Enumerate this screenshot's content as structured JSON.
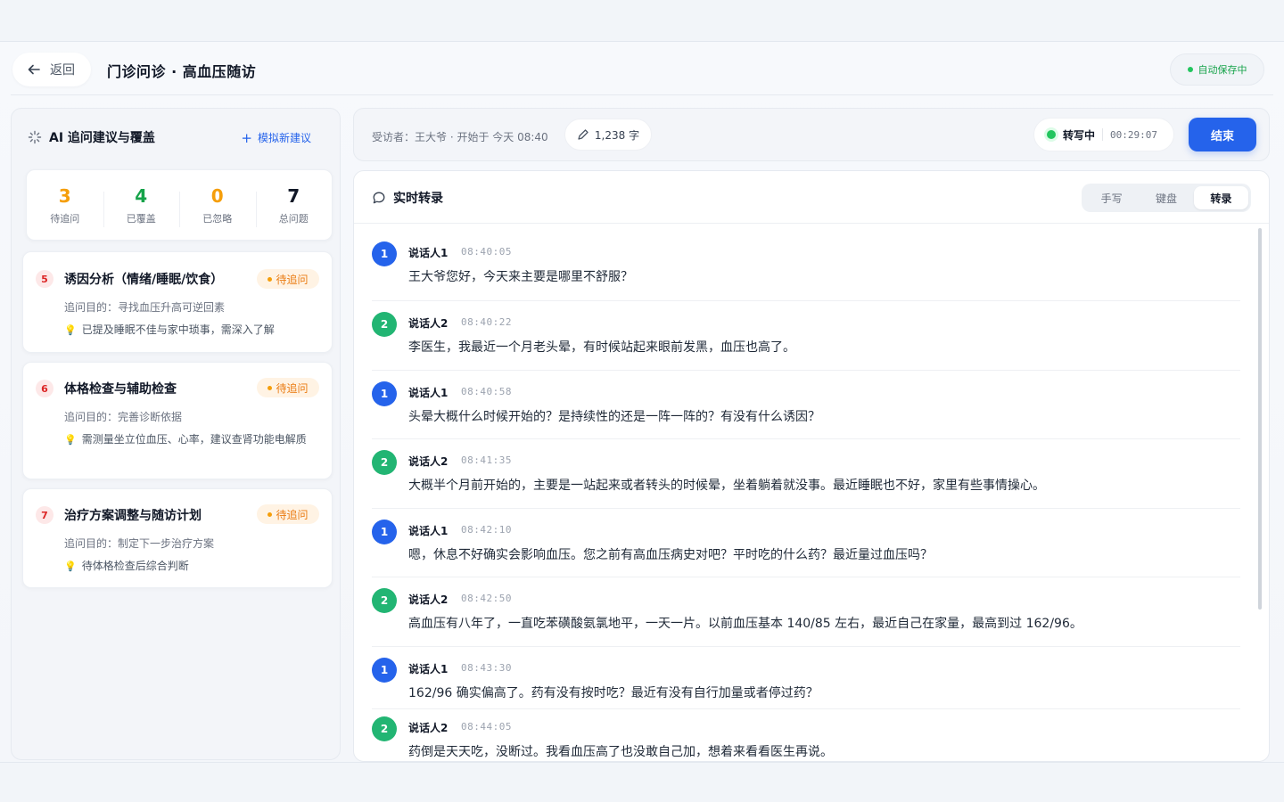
{
  "header": {
    "back_label": "返回",
    "title": "门诊问诊 · 高血压随访",
    "autosave": "自动保存中"
  },
  "left": {
    "title": "AI 追问建议与覆盖",
    "action": "模拟新建议",
    "stats": [
      {
        "value": "3",
        "label": "待追问",
        "color": "#f59e0b"
      },
      {
        "value": "4",
        "label": "已覆盖",
        "color": "#16a34a"
      },
      {
        "value": "0",
        "label": "已忽略",
        "color": "#f59e0b"
      },
      {
        "value": "7",
        "label": "总问题",
        "color": "#111827"
      }
    ],
    "questions": [
      {
        "num": "5",
        "title": "诱因分析（情绪/睡眠/饮食）",
        "badge": "待追问",
        "purpose": "追问目的：寻找血压升高可逆回素",
        "note": "已提及睡眠不佳与家中琐事，需深入了解"
      },
      {
        "num": "6",
        "title": "体格检查与辅助检查",
        "badge": "待追问",
        "purpose": "追问目的：完善诊断依据",
        "note": "需测量坐立位血压、心率，建议查肾功能电解质"
      },
      {
        "num": "7",
        "title": "治疗方案调整与随访计划",
        "badge": "待追问",
        "purpose": "追问目的：制定下一步治疗方案",
        "note": "待体格检查后综合判断"
      }
    ]
  },
  "topbar": {
    "meta": "受访者：王大爷 · 开始于 今天 08:40",
    "word_count": "1,238 字",
    "rec_label": "转写中",
    "rec_time": "00:29:07",
    "end_label": "结束"
  },
  "transcript": {
    "title": "实时转录",
    "modes": [
      "手写",
      "键盘",
      "转录"
    ],
    "active_mode": "转录",
    "messages": [
      {
        "n": "1",
        "speaker": "说话人1",
        "time": "08:40:05",
        "text": "王大爷您好，今天来主要是哪里不舒服？"
      },
      {
        "n": "2",
        "speaker": "说话人2",
        "time": "08:40:22",
        "text": "李医生，我最近一个月老头晕，有时候站起来眼前发黑，血压也高了。"
      },
      {
        "n": "1",
        "speaker": "说话人1",
        "time": "08:40:58",
        "text": "头晕大概什么时候开始的？是持续性的还是一阵一阵的？有没有什么诱因？"
      },
      {
        "n": "2",
        "speaker": "说话人2",
        "time": "08:41:35",
        "text": "大概半个月前开始的，主要是一站起来或者转头的时候晕，坐着躺着就没事。最近睡眠也不好，家里有些事情操心。"
      },
      {
        "n": "1",
        "speaker": "说话人1",
        "time": "08:42:10",
        "text": "嗯，休息不好确实会影响血压。您之前有高血压病史对吧？平时吃的什么药？最近量过血压吗？"
      },
      {
        "n": "2",
        "speaker": "说话人2",
        "time": "08:42:50",
        "text": "高血压有八年了，一直吃苯磺酸氨氯地平，一天一片。以前血压基本 140/85 左右，最近自己在家量，最高到过 162/96。"
      },
      {
        "n": "1",
        "speaker": "说话人1",
        "time": "08:43:30",
        "text": "162/96 确实偏高了。药有没有按时吃？最近有没有自行加量或者停过药？"
      },
      {
        "n": "2",
        "speaker": "说话人2",
        "time": "08:44:05",
        "text": "药倒是天天吃，没断过。我看血压高了也没敢自己加，想着来看看医生再说。"
      }
    ]
  }
}
